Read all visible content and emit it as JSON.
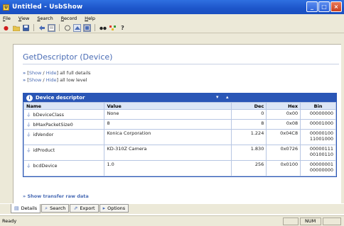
{
  "window": {
    "title": "Untitled - UsbShow",
    "buttons": [
      "_",
      "□",
      "×"
    ]
  },
  "menu": [
    "File",
    "View",
    "Search",
    "Record",
    "Help"
  ],
  "toolbar": {
    "icons": [
      "record-icon",
      "open-icon",
      "save-icon",
      "back-icon",
      "details-icon",
      "filter-icon",
      "capture-icon",
      "view-icon",
      "find-icon",
      "tree-icon",
      "help-icon"
    ]
  },
  "document": {
    "heading": "GetDescriptor (Device)",
    "link_full": {
      "bullet": "»",
      "show": "Show",
      "hide": "Hide",
      "suffix": "all full details"
    },
    "link_low": {
      "bullet": "»",
      "show": "Show",
      "hide": "Hide",
      "suffix": "all low level"
    },
    "table_title": "Device descriptor",
    "table_arrows": "▾ ▴",
    "columns": [
      "Name",
      "Value",
      "Dec",
      "Hex",
      "Bin"
    ],
    "rows": [
      {
        "name": "bDeviceClass",
        "value": "None",
        "dec": "0",
        "hex": "0x00",
        "bin": [
          "00000000"
        ]
      },
      {
        "name": "bMaxPacketSize0",
        "value": "8",
        "dec": "8",
        "hex": "0x08",
        "bin": [
          "00001000"
        ]
      },
      {
        "name": "idVendor",
        "value": "Konica Corporation",
        "dec": "1.224",
        "hex": "0x04C8",
        "bin": [
          "00000100",
          "11001000"
        ]
      },
      {
        "name": "idProduct",
        "value": "KD-310Z Camera",
        "dec": "1.830",
        "hex": "0x0726",
        "bin": [
          "00000111",
          "00100110"
        ]
      },
      {
        "name": "bcdDevice",
        "value": "1.0",
        "dec": "256",
        "hex": "0x0100",
        "bin": [
          "00000001",
          "00000000"
        ]
      }
    ],
    "raw_link": "» Show transfer raw data"
  },
  "tabs": [
    {
      "label": "Details",
      "icon": "details-icon",
      "active": true
    },
    {
      "label": "Search",
      "icon": "search-icon",
      "active": false
    },
    {
      "label": "Export",
      "icon": "export-icon",
      "active": false
    },
    {
      "label": "Options",
      "icon": "options-icon",
      "active": false
    }
  ],
  "status": {
    "text": "Ready",
    "num": "NUM"
  }
}
